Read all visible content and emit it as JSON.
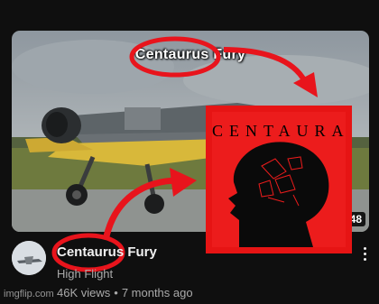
{
  "thumbnail": {
    "title_text": "Centaurus Fury",
    "duration": "48"
  },
  "album_art": {
    "title": "CENTAURA"
  },
  "video": {
    "title": "Centaurus Fury",
    "channel": "High Flight",
    "views": "46K views",
    "separator": "•",
    "age": "7 months ago"
  },
  "watermark": "imgflip.com",
  "colors": {
    "background": "#0f0f0f",
    "annotation_red": "#e8141c",
    "album_red": "#ec1c1c",
    "plane_yellow": "#d8b83a"
  },
  "icons": [
    "more-vert-icon",
    "plane-avatar-icon"
  ]
}
